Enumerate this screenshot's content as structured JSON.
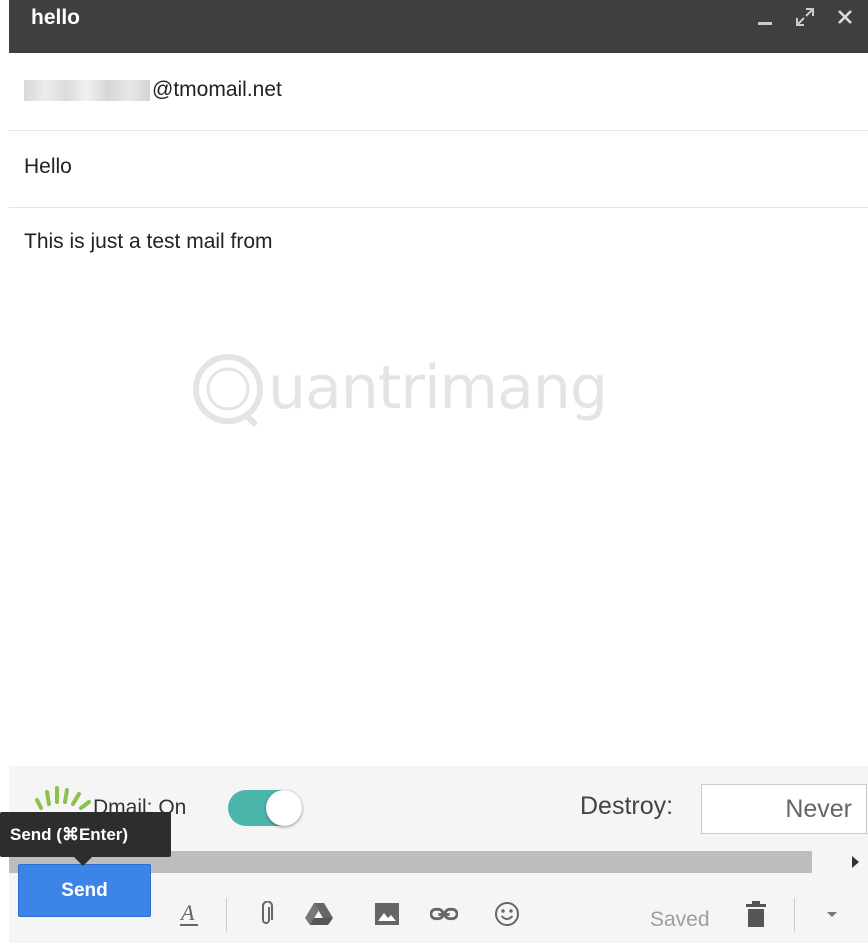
{
  "window": {
    "title": "hello"
  },
  "to": {
    "value_suffix": "@tmomail.net"
  },
  "subject": {
    "value": "Hello"
  },
  "body": {
    "text": "This is just a test mail from"
  },
  "dmail": {
    "label": "Dmail: On",
    "toggle_on": true,
    "accent": "#4db6ac"
  },
  "destroy": {
    "label": "Destroy:",
    "value": "Never"
  },
  "send": {
    "label": "Send",
    "tooltip": "Send (⌘Enter)",
    "color": "#3b84e8"
  },
  "toolbar": {
    "saved_label": "Saved"
  },
  "watermark": {
    "text": "uantrimang"
  },
  "icons": {
    "minimize": "minimize-icon",
    "expand": "expand-icon",
    "close": "close-icon",
    "formatting": "text-format-icon",
    "attach": "paperclip-icon",
    "drive": "drive-icon",
    "photo": "photo-icon",
    "link": "link-icon",
    "emoji": "emoji-icon",
    "trash": "trash-icon",
    "more": "chevron-down-icon"
  }
}
